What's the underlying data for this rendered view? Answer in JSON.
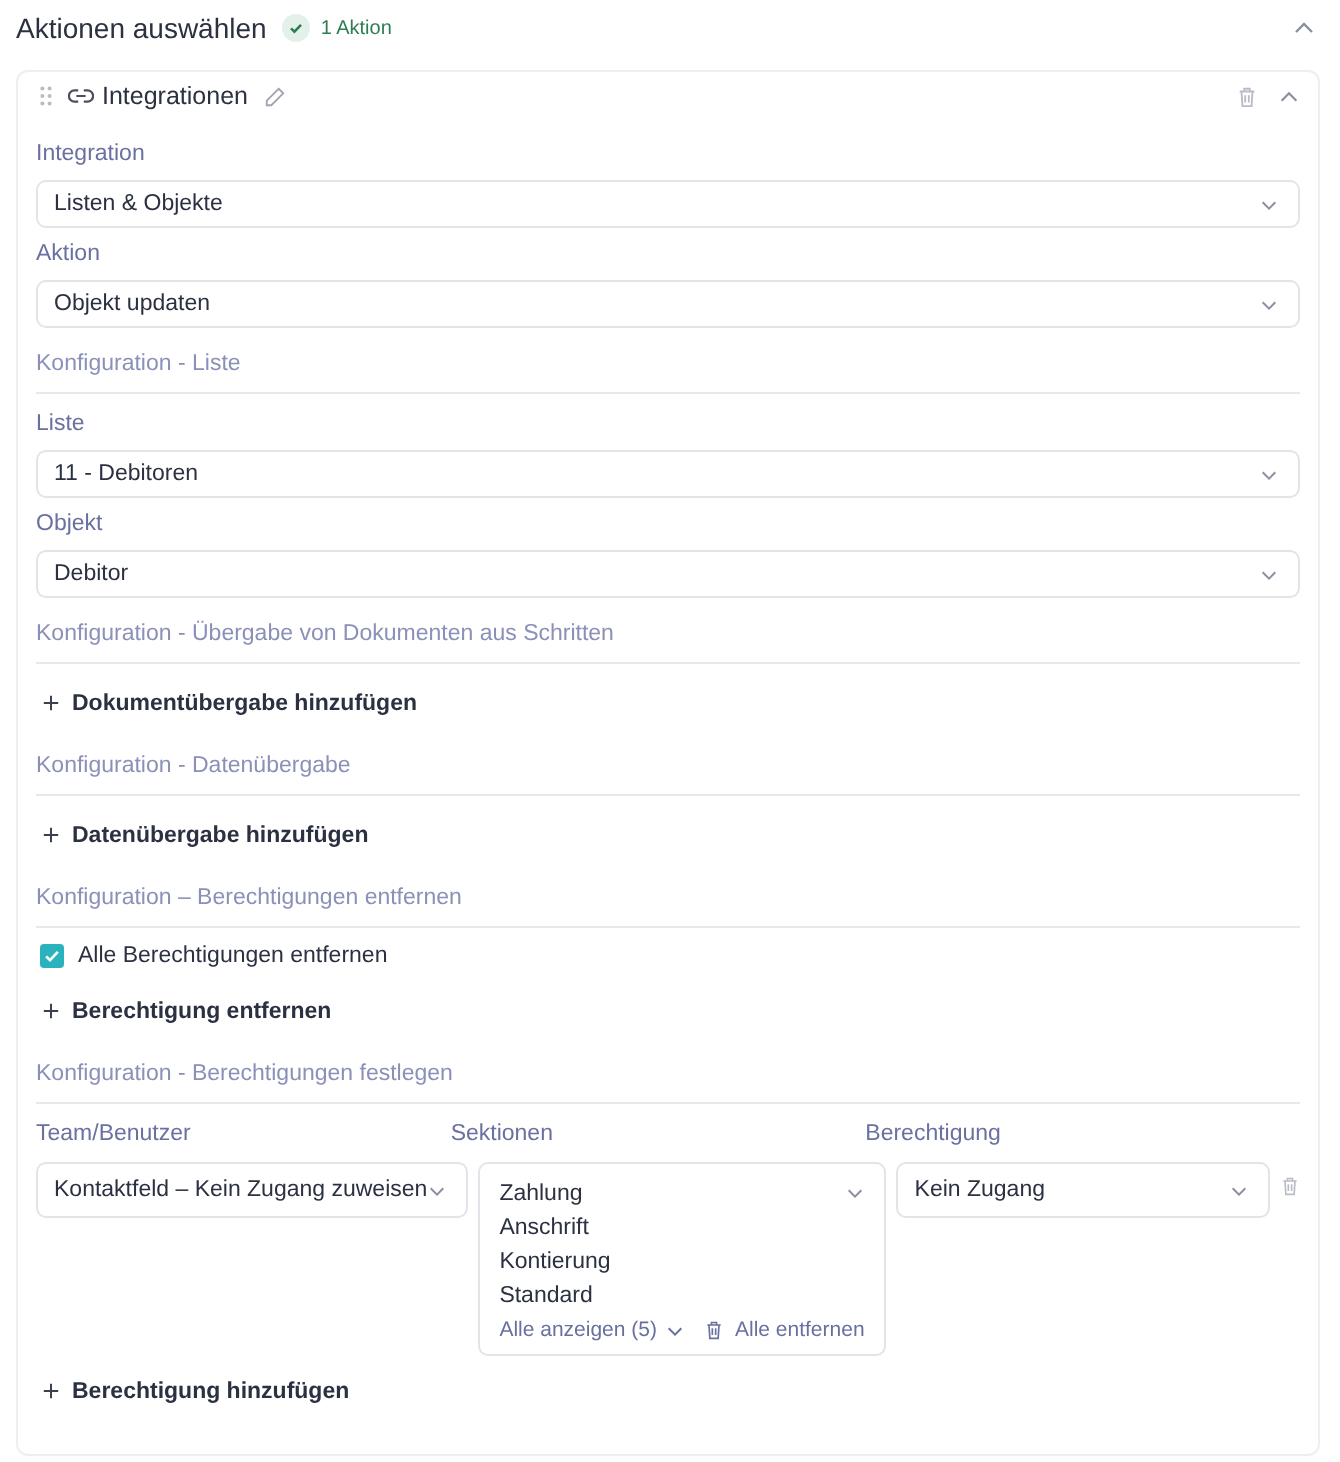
{
  "header": {
    "title": "Aktionen auswählen",
    "badge": "1 Aktion",
    "expanded": true
  },
  "action": {
    "title": "Integrationen",
    "expanded": true,
    "blocks": [
      {
        "kind": "select",
        "label": "Integration",
        "value": "Listen & Objekte"
      },
      {
        "kind": "select",
        "label": "Aktion",
        "value": "Objekt updaten"
      },
      {
        "kind": "section",
        "label": "Konfiguration - Liste"
      },
      {
        "kind": "select",
        "label": "Liste",
        "value": "11 - Debitoren"
      },
      {
        "kind": "select",
        "label": "Objekt",
        "value": "Debitor"
      },
      {
        "kind": "section",
        "label": "Konfiguration - Übergabe von Dokumenten aus Schritten"
      },
      {
        "kind": "add",
        "label": "Dokumentübergabe hinzufügen"
      },
      {
        "kind": "section",
        "label": "Konfiguration - Datenübergabe"
      },
      {
        "kind": "add",
        "label": "Datenübergabe hinzufügen"
      },
      {
        "kind": "section",
        "label": "Konfiguration – Berechtigungen entfernen"
      },
      {
        "kind": "checkbox",
        "label": "Alle Berechtigungen entfernen",
        "checked": true
      },
      {
        "kind": "add",
        "label": "Berechtigung entfernen"
      },
      {
        "kind": "section",
        "label": "Konfiguration - Berechtigungen festlegen"
      },
      {
        "kind": "permissions",
        "columns": [
          "Team/Benutzer",
          "Sektionen",
          "Berechtigung"
        ],
        "rows": [
          {
            "team": "Kontaktfeld – Kein Zugang zuweisen",
            "sections": [
              "Zahlung",
              "Anschrift",
              "Kontierung",
              "Standard"
            ],
            "show_all": "Alle anzeigen (5)",
            "remove_all": "Alle entfernen",
            "permission": "Kein Zugang"
          }
        ]
      },
      {
        "kind": "add",
        "label": "Berechtigung hinzufügen"
      }
    ]
  }
}
